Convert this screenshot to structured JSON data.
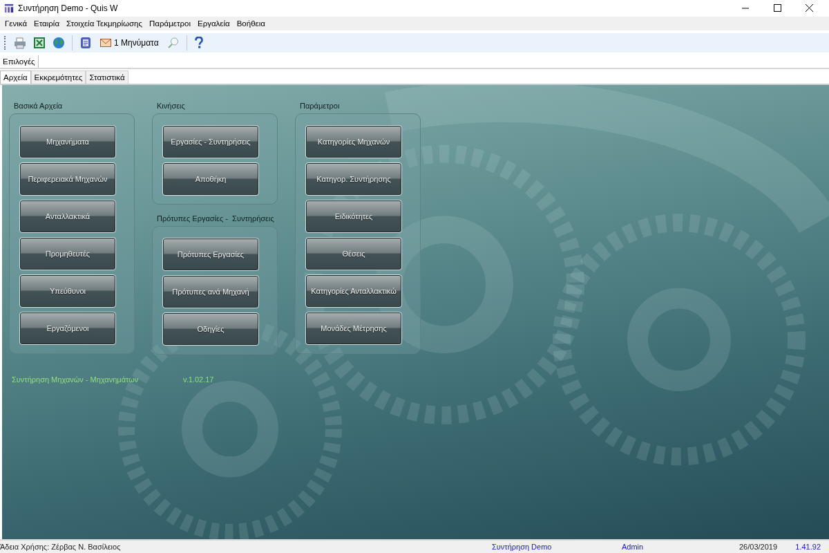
{
  "window": {
    "title": "Συντήρηση Demo - Quis W"
  },
  "menu": [
    "Γενικά",
    "Εταιρία",
    "Στοιχεία Τεκμηρίωσης",
    "Παράμετροι",
    "Εργαλεία",
    "Βοήθεια"
  ],
  "toolbar": {
    "messages": "1 Μηνύματα"
  },
  "options_tab": {
    "label": "Επιλογές",
    "selected": true
  },
  "tabs": [
    {
      "label": "Αρχεία",
      "selected": true
    },
    {
      "label": "Εκκρεμότητες",
      "selected": false
    },
    {
      "label": "Στατιστικά",
      "selected": false
    }
  ],
  "columns": [
    [
      {
        "title": "Βασικά Αρχεία",
        "buttons": [
          "Μηχανήματα",
          "Περιφερειακά Μηχανών",
          "Ανταλλακτικά",
          "Προμηθευτές",
          "Υπεύθυνοι",
          "Εργαζόμενοι"
        ]
      }
    ],
    [
      {
        "title": "Κινήσεις",
        "buttons": [
          "Εργασίες - Συντηρήσεις",
          "Αποθήκη"
        ]
      },
      {
        "title": "Πρότυπες Εργασίες -  Συντηρήσεις",
        "buttons": [
          "Πρότυπες Εργασίες",
          "Πρότυπες ανά Μηχανή",
          "Οδηγίες"
        ]
      }
    ],
    [
      {
        "title": "Παράμετροι",
        "buttons": [
          "Κατηγορίες Μηχανών",
          "Κατηγορ. Συντήρησης",
          "Ειδικότητες",
          "Θέσεις",
          "Κατηγορίες Ανταλλακτικώ",
          "Μονάδες Μέτρησης"
        ]
      }
    ]
  ],
  "footer": {
    "app_name": "Συντήρηση Μηχανών - Μηχανημάτων",
    "version": "v.1.02.17"
  },
  "status_bar": {
    "license": "Άδεια Χρήσης: Ζέρβας Ν. Βασίλειος",
    "company": "Συντήρηση Demo",
    "user": "Admin",
    "date": "26/03/2019",
    "build": "1.41.92"
  }
}
